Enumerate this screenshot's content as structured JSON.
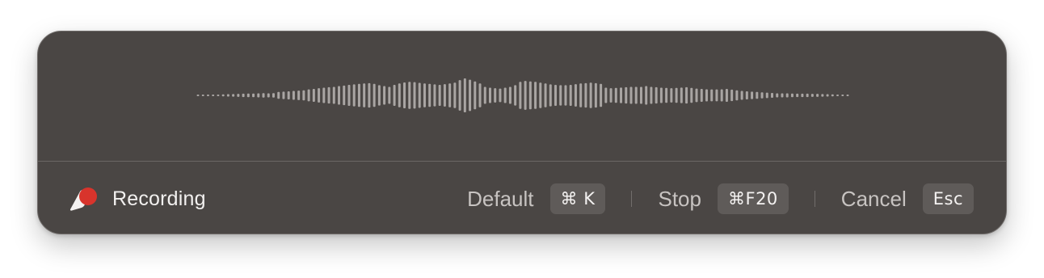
{
  "status": {
    "label": "Recording",
    "icon": "recording-icon",
    "accent": "#d8342c"
  },
  "shortcuts": [
    {
      "label": "Default",
      "key": "⌘ K"
    },
    {
      "label": "Stop",
      "key": "⌘F20"
    },
    {
      "label": "Cancel",
      "key": "Esc"
    }
  ],
  "waveform": {
    "color": "#a9a5a3",
    "levels": [
      0.04,
      0.04,
      0.04,
      0.05,
      0.05,
      0.06,
      0.07,
      0.08,
      0.09,
      0.1,
      0.11,
      0.11,
      0.12,
      0.13,
      0.12,
      0.13,
      0.2,
      0.22,
      0.24,
      0.26,
      0.28,
      0.3,
      0.35,
      0.38,
      0.42,
      0.45,
      0.48,
      0.5,
      0.55,
      0.58,
      0.62,
      0.65,
      0.68,
      0.7,
      0.72,
      0.68,
      0.6,
      0.55,
      0.5,
      0.62,
      0.7,
      0.76,
      0.8,
      0.78,
      0.74,
      0.7,
      0.68,
      0.65,
      0.62,
      0.66,
      0.7,
      0.75,
      0.9,
      1.0,
      0.92,
      0.82,
      0.7,
      0.5,
      0.45,
      0.42,
      0.4,
      0.45,
      0.5,
      0.6,
      0.8,
      0.85,
      0.82,
      0.8,
      0.75,
      0.7,
      0.65,
      0.62,
      0.6,
      0.6,
      0.62,
      0.66,
      0.7,
      0.72,
      0.75,
      0.72,
      0.68,
      0.45,
      0.42,
      0.44,
      0.46,
      0.48,
      0.5,
      0.5,
      0.5,
      0.55,
      0.5,
      0.48,
      0.45,
      0.44,
      0.42,
      0.44,
      0.46,
      0.48,
      0.44,
      0.4,
      0.38,
      0.36,
      0.35,
      0.35,
      0.36,
      0.38,
      0.34,
      0.3,
      0.26,
      0.24,
      0.22,
      0.2,
      0.18,
      0.16,
      0.14,
      0.12,
      0.12,
      0.12,
      0.11,
      0.1,
      0.1,
      0.1,
      0.09,
      0.09,
      0.08,
      0.07,
      0.06,
      0.05,
      0.05,
      0.04
    ]
  }
}
